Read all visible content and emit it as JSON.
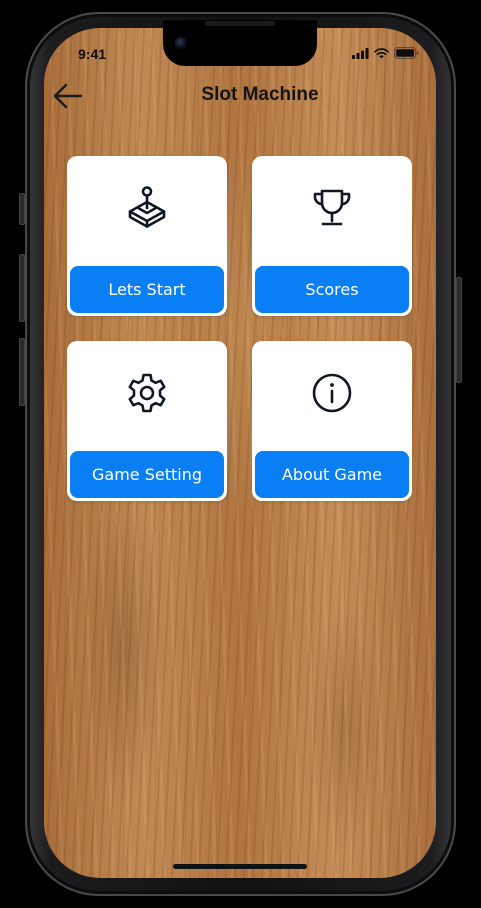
{
  "status_bar": {
    "time": "9:41"
  },
  "header": {
    "title": "Slot Machine",
    "back_icon": "arrow-left-icon"
  },
  "menu": {
    "items": [
      {
        "label": "Lets Start",
        "icon": "joystick-icon"
      },
      {
        "label": "Scores",
        "icon": "trophy-icon"
      },
      {
        "label": "Game Setting",
        "icon": "gear-icon"
      },
      {
        "label": "About Game",
        "icon": "info-icon"
      }
    ]
  },
  "colors": {
    "accent": "#0a7ff5",
    "card_bg": "#ffffff",
    "icon_stroke": "#0f1724",
    "title_text": "#141414"
  }
}
